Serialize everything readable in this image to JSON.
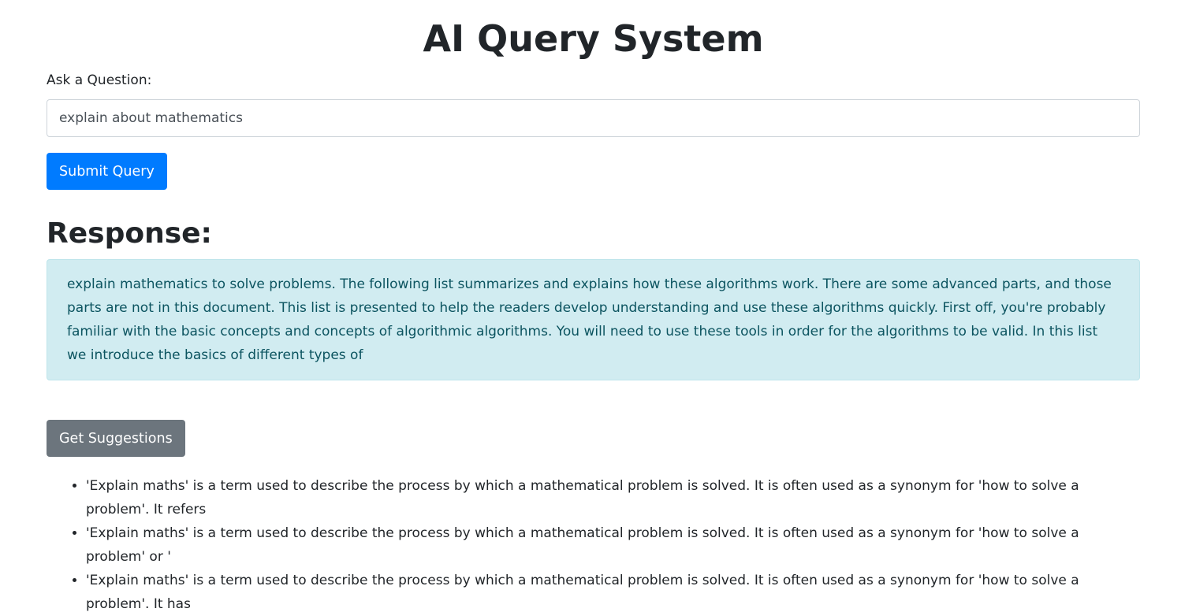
{
  "page": {
    "title": "AI Query System"
  },
  "query": {
    "label": "Ask a Question:",
    "value": "explain about mathematics",
    "submit_label": "Submit Query"
  },
  "response": {
    "heading": "Response:",
    "text": "explain mathematics to solve problems. The following list summarizes and explains how these algorithms work. There are some advanced parts, and those parts are not in this document. This list is presented to help the readers develop understanding and use these algorithms quickly. First off, you're probably familiar with the basic concepts and concepts of algorithmic algorithms. You will need to use these tools in order for the algorithms to be valid. In this list we introduce the basics of different types of"
  },
  "suggestions": {
    "button_label": "Get Suggestions",
    "items": [
      "'Explain maths' is a term used to describe the process by which a mathematical problem is solved. It is often used as a synonym for 'how to solve a problem'. It refers",
      "'Explain maths' is a term used to describe the process by which a mathematical problem is solved. It is often used as a synonym for 'how to solve a problem' or '",
      "'Explain maths' is a term used to describe the process by which a mathematical problem is solved. It is often used as a synonym for 'how to solve a problem'. It has"
    ]
  },
  "colors": {
    "primary": "#007bff",
    "secondary": "#6c757d",
    "info_bg": "#d1ecf1",
    "info_text": "#0c5460"
  }
}
